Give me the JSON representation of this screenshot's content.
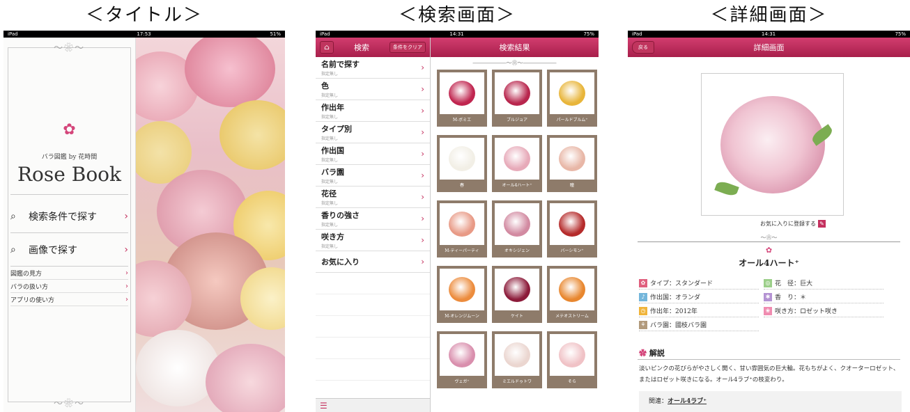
{
  "section_titles": [
    "＜タイトル＞",
    "＜検索画面＞",
    "＜詳細画面＞"
  ],
  "title_screen": {
    "status": {
      "left": "iPad",
      "time": "17:53",
      "right": "51%"
    },
    "subtitle": "バラ図鑑 by 花時間",
    "app_name": "Rose Book",
    "buttons": [
      {
        "label": "検索条件で探す"
      },
      {
        "label": "画像で探す"
      }
    ],
    "links": [
      {
        "label": "図鑑の見方"
      },
      {
        "label": "バラの扱い方"
      },
      {
        "label": "アプリの使い方"
      }
    ]
  },
  "search_screen": {
    "status": {
      "left": "iPad",
      "time": "14:31",
      "right": "75%"
    },
    "left_title": "検索",
    "clear_label": "条件をクリア",
    "right_title": "検索結果",
    "criteria": [
      {
        "label": "名前で探す",
        "value": "指定無し"
      },
      {
        "label": "色",
        "value": "指定無し"
      },
      {
        "label": "作出年",
        "value": "指定無し"
      },
      {
        "label": "タイプ別",
        "value": "指定無し"
      },
      {
        "label": "作出国",
        "value": "指定無し"
      },
      {
        "label": "バラ園",
        "value": "指定無し"
      },
      {
        "label": "花径",
        "value": "指定無し"
      },
      {
        "label": "香りの強さ",
        "value": "指定無し"
      },
      {
        "label": "咲き方",
        "value": "指定無し"
      },
      {
        "label": "お気に入り",
        "value": ""
      }
    ],
    "results": [
      {
        "name": "M-ボミエ",
        "color": "#c0254f"
      },
      {
        "name": "ブルジョア",
        "color": "#b8264d"
      },
      {
        "name": "パールドブルム⁺",
        "color": "#e8b53a"
      },
      {
        "name": "春",
        "color": "#f2efe6"
      },
      {
        "name": "オール4ハート⁺",
        "color": "#e7aab9"
      },
      {
        "name": "瞳",
        "color": "#e8b7a7"
      },
      {
        "name": "M-ティーパーティ",
        "color": "#e89a86"
      },
      {
        "name": "オキシジェン",
        "color": "#d28aa1"
      },
      {
        "name": "バーシモン⁺",
        "color": "#b52b2b"
      },
      {
        "name": "M-オレンジムーン",
        "color": "#ec8c3d"
      },
      {
        "name": "ケイト",
        "color": "#8c1b3a"
      },
      {
        "name": "メテオストリーム",
        "color": "#e8872f"
      },
      {
        "name": "ヴェガ⁺",
        "color": "#d98fad"
      },
      {
        "name": "ミエルドゥトワ",
        "color": "#ebd6d0"
      },
      {
        "name": "そら",
        "color": "#f0c2c6"
      }
    ]
  },
  "detail_screen": {
    "status": {
      "left": "iPad",
      "time": "14:31",
      "right": "75%"
    },
    "back_label": "戻る",
    "title": "詳細画面",
    "favorite_label": "お気に入りに登録する",
    "rose_name": "オール4ハート⁺",
    "attrs": [
      {
        "text": "タイプ：スタンダード",
        "color": "#e0607e"
      },
      {
        "text": "花　径：巨大",
        "color": "#9ccf8a"
      },
      {
        "text": "作出国：オランダ",
        "color": "#74b6db"
      },
      {
        "text": "香　り：＊",
        "color": "#b493d3"
      },
      {
        "text": "作出年：2012年",
        "color": "#f0b43a"
      },
      {
        "text": "咲き方：ロゼット咲き",
        "color": "#f08cb0"
      },
      {
        "text": "バラ園：國枝バラ園",
        "color": "#b29a7c"
      }
    ],
    "section_heading": "解説",
    "description": "淡いピンクの花びらがやさしく開く、甘い雰囲気の巨大輪。花もちがよく、クオーターロゼット、またはロゼット咲きになる。オール4ラブ⁺の枝変わり。",
    "related_label": "関連：",
    "related_link": "オール4ラブ⁺"
  }
}
